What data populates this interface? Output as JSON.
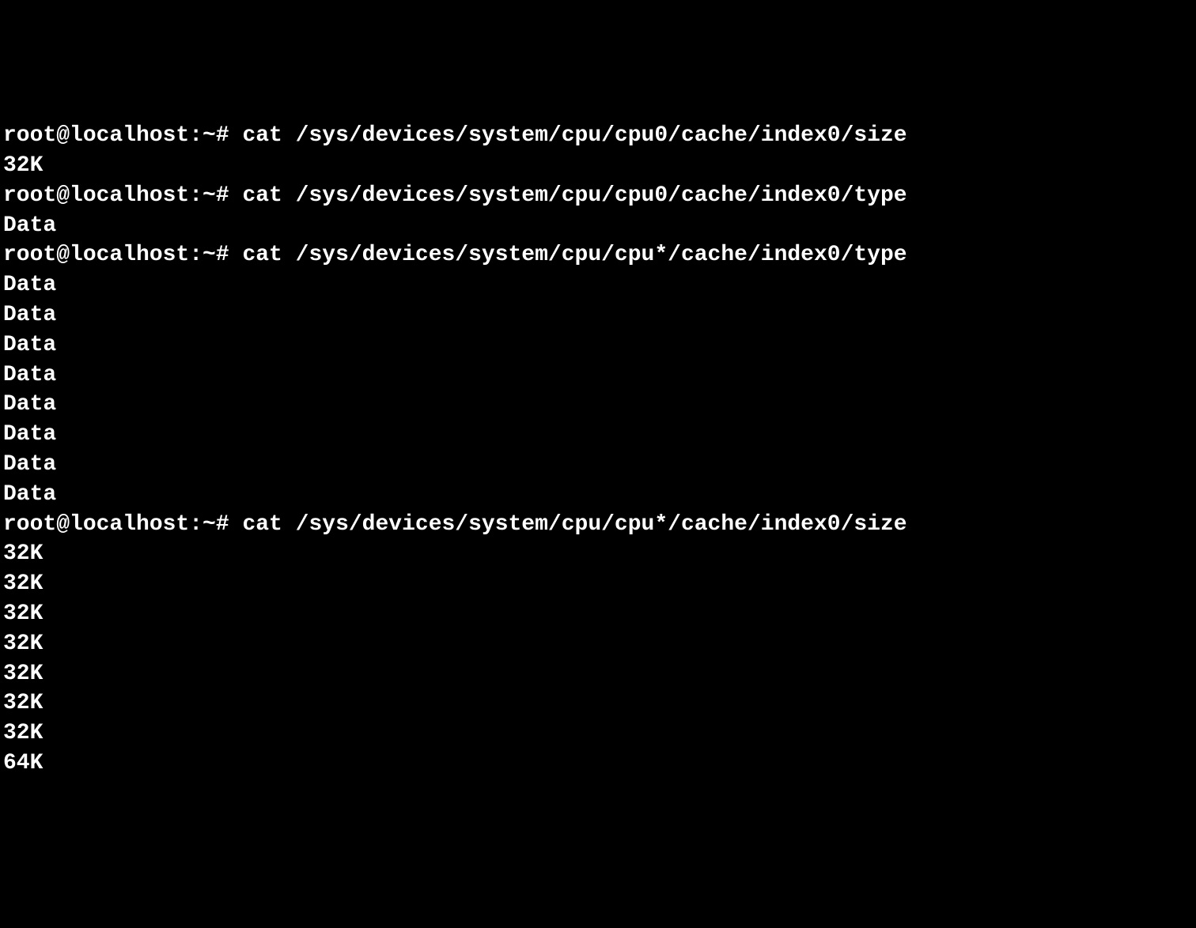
{
  "terminal": {
    "prompt": "root@localhost:~# ",
    "entries": [
      {
        "command": "cat /sys/devices/system/cpu/cpu0/cache/index0/size",
        "output": [
          "32K"
        ]
      },
      {
        "command": "cat /sys/devices/system/cpu/cpu0/cache/index0/type",
        "output": [
          "Data"
        ]
      },
      {
        "command": "cat /sys/devices/system/cpu/cpu*/cache/index0/type",
        "output": [
          "Data",
          "Data",
          "Data",
          "Data",
          "Data",
          "Data",
          "Data",
          "Data"
        ]
      },
      {
        "command": "cat /sys/devices/system/cpu/cpu*/cache/index0/size",
        "output": [
          "32K",
          "32K",
          "32K",
          "32K",
          "32K",
          "32K",
          "32K",
          "64K"
        ]
      }
    ]
  }
}
